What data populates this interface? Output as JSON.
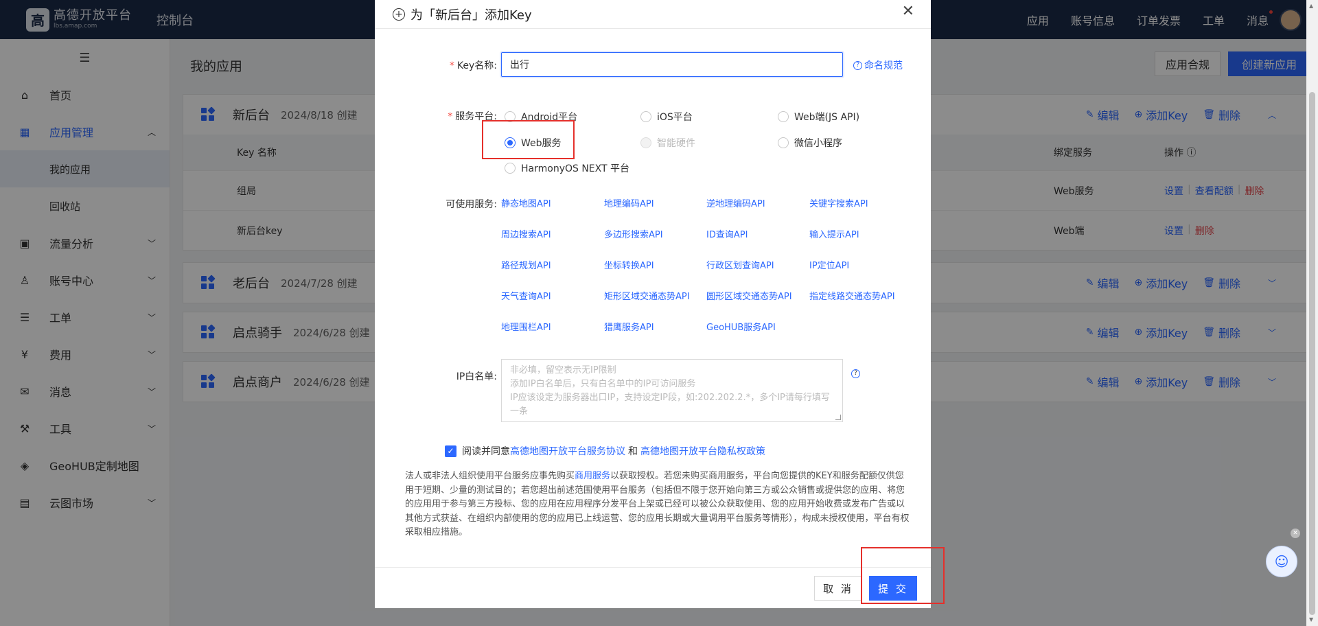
{
  "topbar": {
    "logo_mark": "高",
    "logo_title": "高德开放平台",
    "logo_sub": "lbs.amap.com",
    "console": "控制台",
    "nav": [
      "应用",
      "账号信息",
      "订单发票",
      "工单",
      "消息"
    ]
  },
  "sidebar": {
    "collapse_glyph": "☰",
    "items": [
      {
        "label": "首页",
        "icon": "⌂"
      },
      {
        "label": "应用管理",
        "icon": "▦"
      },
      {
        "label": "我的应用"
      },
      {
        "label": "回收站"
      },
      {
        "label": "流量分析",
        "icon": "▣"
      },
      {
        "label": "账号中心",
        "icon": "♙"
      },
      {
        "label": "工单",
        "icon": "☰"
      },
      {
        "label": "费用",
        "icon": "¥"
      },
      {
        "label": "消息",
        "icon": "✉"
      },
      {
        "label": "工具",
        "icon": "⚒"
      },
      {
        "label": "GeoHUB定制地图",
        "icon": "◈"
      },
      {
        "label": "云图市场",
        "icon": "▤"
      }
    ]
  },
  "main": {
    "title": "我的应用",
    "compliance_button": "应用合规",
    "create_button": "创建新应用",
    "action_edit": "编辑",
    "action_add_key": "添加Key",
    "action_delete": "删除",
    "apps": [
      {
        "name": "新后台",
        "date": "2024/8/18 创建"
      },
      {
        "name": "老后台",
        "date": "2024/7/28 创建"
      },
      {
        "name": "启点骑手",
        "date": "2024/6/28 创建"
      },
      {
        "name": "启点商户",
        "date": "2024/6/28 创建"
      }
    ],
    "table": {
      "col_name": "Key 名称",
      "col_bind": "绑定服务",
      "col_op": "操作 ⓘ",
      "rows": [
        {
          "name": "组局",
          "bind": "Web服务",
          "ops": [
            "设置",
            "查看配额",
            "删除"
          ]
        },
        {
          "name": "新后台key",
          "bind": "Web端",
          "ops": [
            "设置",
            "删除"
          ]
        }
      ]
    }
  },
  "modal": {
    "title": "为「新后台」添加Key",
    "key_label": "Key名称:",
    "key_value": "出行",
    "naming_rule": "命名规范",
    "platform_label": "服务平台:",
    "platforms": [
      {
        "label": "Android平台"
      },
      {
        "label": "iOS平台"
      },
      {
        "label": "Web端(JS API)"
      },
      {
        "label": "Web服务"
      },
      {
        "label": "智能硬件"
      },
      {
        "label": "微信小程序"
      },
      {
        "label": "HarmonyOS NEXT 平台"
      }
    ],
    "services_label": "可使用服务:",
    "services": [
      "静态地图API",
      "地理编码API",
      "逆地理编码API",
      "关键字搜索API",
      "周边搜索API",
      "多边形搜索API",
      "ID查询API",
      "输入提示API",
      "路径规划API",
      "坐标转换API",
      "行政区划查询API",
      "IP定位API",
      "天气查询API",
      "矩形区域交通态势API",
      "圆形区域交通态势API",
      "指定线路交通态势API",
      "地理围栏API",
      "猎鹰服务API",
      "GeoHUB服务API"
    ],
    "ip_label": "IP白名单:",
    "ip_placeholder_lines": [
      "非必填，留空表示无IP限制",
      "添加IP白名单后，只有白名单中的IP可访问服务",
      "IP应该设定为服务器出口IP，支持设定IP段，如:202.202.2.*，多个IP请每行填写",
      "一条"
    ],
    "agree_prefix": "阅读并同意",
    "agree_link1": "高德地图开放平台服务协议",
    "agree_and": "和",
    "agree_link2": "高德地图开放平台隐私权政策",
    "notice_part1": "法人或非法人组织使用平台服务应事先购买",
    "notice_link": "商用服务",
    "notice_part2": "以获取授权。若您未购买商用服务，平台向您提供的KEY和服务配额仅供您用于短期、少量的测试目的；若您超出前述范围使用平台服务（包括但不限于您开始向第三方或公众销售或提供您的应用、将您的应用用于参与第三方投标、您的应用在应用程序分发平台上架或已经可以被公众获取使用、您的应用开始收费或发布广告或以其他方式获益、在组织内部使用的您的应用已上线运营、您的应用长期或大量调用平台服务等情形），构成未授权使用，平台有权采取相应措施。",
    "cancel": "取 消",
    "submit": "提 交"
  },
  "colors": {
    "primary": "#2c68ff",
    "topbar": "#1b2a47",
    "danger": "#e5484d",
    "highlight": "#e5302b"
  }
}
